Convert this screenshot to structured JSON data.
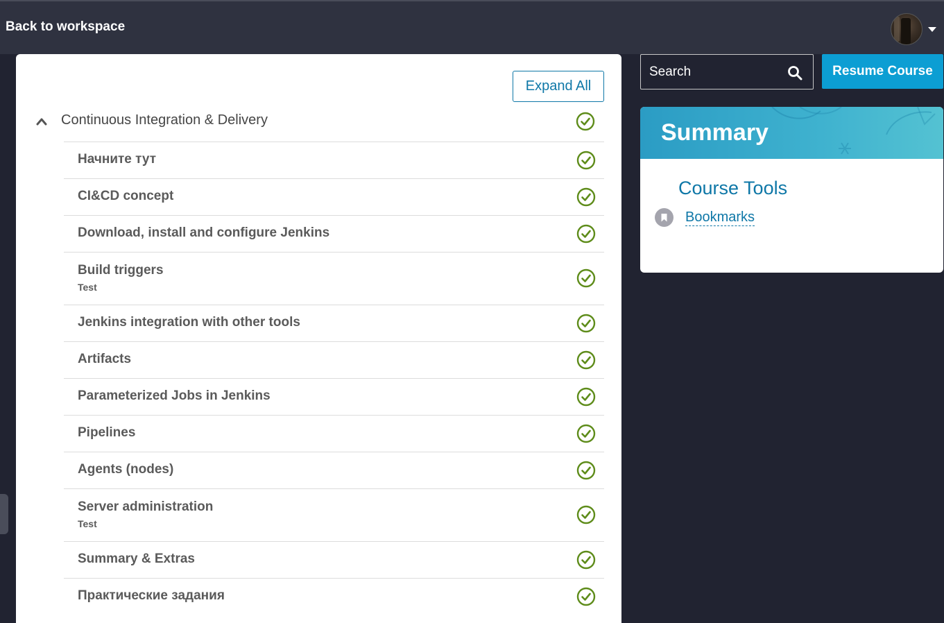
{
  "header": {
    "back_label": "Back to workspace"
  },
  "outline": {
    "expand_all_label": "Expand All",
    "section": {
      "title": "Continuous Integration & Delivery",
      "completed": true
    },
    "units": [
      {
        "title": "Начните тут",
        "subtitle": "",
        "completed": true
      },
      {
        "title": "CI&CD concept",
        "subtitle": "",
        "completed": true
      },
      {
        "title": "Download, install and configure Jenkins",
        "subtitle": "",
        "completed": true
      },
      {
        "title": "Build triggers",
        "subtitle": "Test",
        "completed": true
      },
      {
        "title": "Jenkins integration with other tools",
        "subtitle": "",
        "completed": true
      },
      {
        "title": "Artifacts",
        "subtitle": "",
        "completed": true
      },
      {
        "title": "Parameterized Jobs in Jenkins",
        "subtitle": "",
        "completed": true
      },
      {
        "title": "Pipelines",
        "subtitle": "",
        "completed": true
      },
      {
        "title": "Agents (nodes)",
        "subtitle": "",
        "completed": true
      },
      {
        "title": "Server administration",
        "subtitle": "Test",
        "completed": true
      },
      {
        "title": "Summary & Extras",
        "subtitle": "",
        "completed": true
      },
      {
        "title": "Практические задания",
        "subtitle": "",
        "completed": true
      }
    ]
  },
  "search": {
    "placeholder": "Search"
  },
  "resume_label": "Resume Course",
  "summary": {
    "title": "Summary",
    "tools_heading": "Course Tools",
    "bookmarks_label": "Bookmarks"
  },
  "colors": {
    "check_green": "#5e8c1a",
    "link_blue": "#0e77a7",
    "resume_blue": "#0c9ed3",
    "background": "#212331"
  }
}
